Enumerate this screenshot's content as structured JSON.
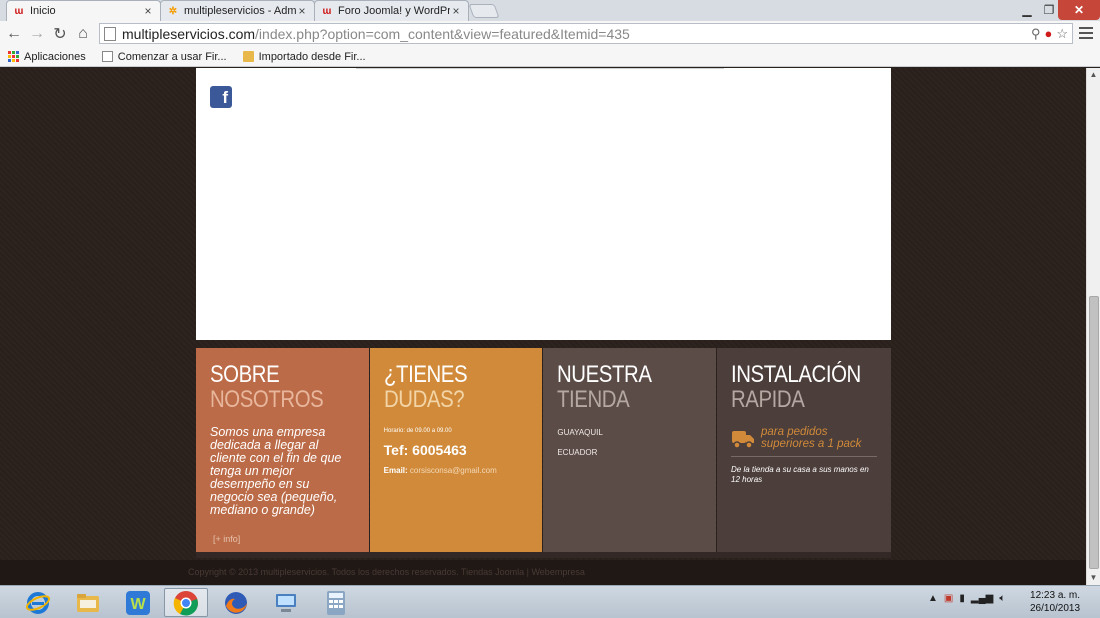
{
  "browser": {
    "tabs": [
      {
        "title": "Inicio",
        "favicon": "w",
        "active": true
      },
      {
        "title": "multipleservicios - Admin",
        "favicon": "joomla",
        "active": false
      },
      {
        "title": "Foro Joomla! y WordPress",
        "favicon": "w",
        "active": false
      }
    ],
    "url_host": "multipleservicios.com",
    "url_path": "/index.php?option=com_content&view=featured&Itemid=435",
    "bookmarks": [
      {
        "label": "Aplicaciones"
      },
      {
        "label": "Comenzar a usar Fir..."
      },
      {
        "label": "Importado desde Fir..."
      }
    ]
  },
  "footer": {
    "about": {
      "title_line1": "SOBRE",
      "title_line2": "NOSOTROS",
      "text": "Somos una empresa dedicada a llegar al cliente con el fin de que tenga un mejor desempeño en su negocio sea (pequeño, mediano o grande)",
      "more_label": "[+ info]"
    },
    "questions": {
      "title_line1": "¿TIENES",
      "title_line2": "DUDAS?",
      "hours": "Horario: de 09.00 a 09.00",
      "phone": "Tef: 6005463",
      "email_label": "Email:",
      "email_value": "corsisconsa@gmail.com"
    },
    "store": {
      "title_line1": "NUESTRA",
      "title_line2": "TIENDA",
      "city": "GUAYAQUIL",
      "country": "ECUADOR"
    },
    "install": {
      "title_line1": "INSTALACIÓN",
      "title_line2": "RAPIDA",
      "delivery_text": "para pedidos superiores a 1 pack",
      "note": "De la tienda a su casa a sus manos en 12 horas"
    },
    "copyright": "Copyright © 2013 multipleservicios. Todos los derechos reservados. Tiendas Joomla | Webempresa"
  },
  "taskbar": {
    "time": "12:23 a. m.",
    "date": "26/10/2013"
  },
  "colors": {
    "orange_box": "#bb6b47",
    "amber_box": "#d08a39",
    "grey_box": "#5b4c48",
    "dark_box": "#4c3e3b",
    "facebook": "#3b5998"
  }
}
